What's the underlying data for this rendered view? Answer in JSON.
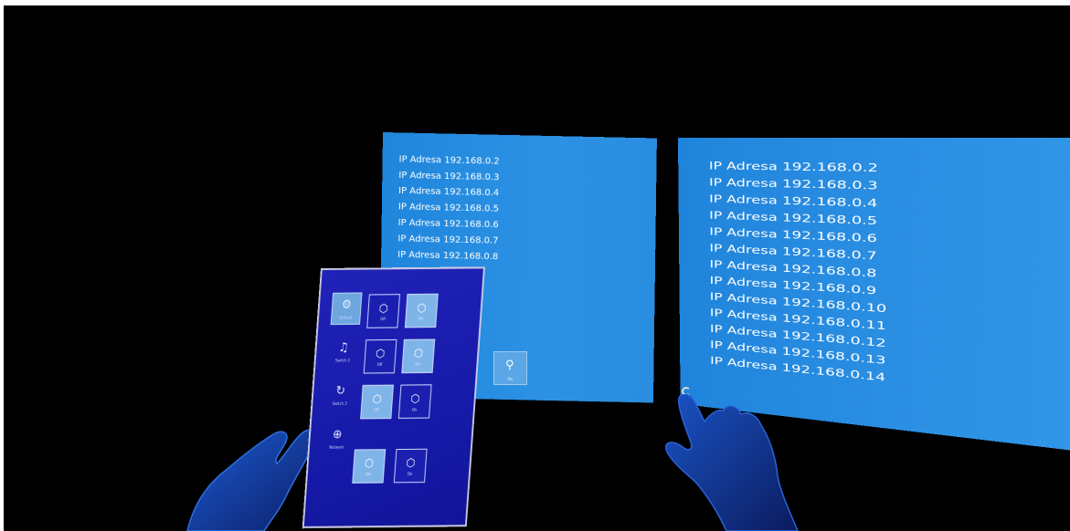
{
  "scene": {
    "background": "#000000"
  },
  "left_panel": {
    "accent": "#2a8ee0",
    "items": [
      "IP Adresa 192.168.0.2",
      "IP Adresa 192.168.0.3",
      "IP Adresa 192.168.0.4",
      "IP Adresa 192.168.0.5",
      "IP Adresa 192.168.0.6",
      "IP Adresa 192.168.0.7",
      "IP Adresa 192.168.0.8"
    ],
    "pin_button": {
      "icon": "pin-icon",
      "label": "Pin"
    }
  },
  "right_panel": {
    "accent": "#2c90e4",
    "items": [
      "IP Adresa 192.168.0.2",
      "IP Adresa 192.168.0.3",
      "IP Adresa 192.168.0.4",
      "IP Adresa 192.168.0.5",
      "IP Adresa 192.168.0.6",
      "IP Adresa 192.168.0.7",
      "IP Adresa 192.168.0.8",
      "IP Adresa 192.168.0.9",
      "IP Adresa 192.168.0.10",
      "IP Adresa 192.168.0.11",
      "IP Adresa 192.168.0.12",
      "IP Adresa 192.168.0.13",
      "IP Adresa 192.168.0.14"
    ]
  },
  "hand_menu": {
    "background": "#1a1db0",
    "nav": [
      {
        "icon": "gear-icon",
        "label": "Default",
        "selected": true
      },
      {
        "icon": "bell-icon",
        "label": "Switch 2",
        "selected": false
      },
      {
        "icon": "refresh-icon",
        "label": "Switch 3",
        "selected": false
      },
      {
        "icon": "globe-icon",
        "label": "Network",
        "selected": false
      }
    ],
    "tiles": [
      {
        "icon": "cube-icon",
        "label": "Off",
        "on": false
      },
      {
        "icon": "cube-icon",
        "label": "On",
        "on": true
      },
      {
        "icon": "cube-icon",
        "label": "Off",
        "on": false
      },
      {
        "icon": "cube-icon",
        "label": "On",
        "on": true
      },
      {
        "icon": "cube-icon",
        "label": "Off",
        "on": true
      },
      {
        "icon": "cube-icon",
        "label": "On",
        "on": false
      },
      {
        "icon": "cube-icon",
        "label": "Off",
        "on": true
      },
      {
        "icon": "cube-icon",
        "label": "On",
        "on": false
      }
    ]
  }
}
